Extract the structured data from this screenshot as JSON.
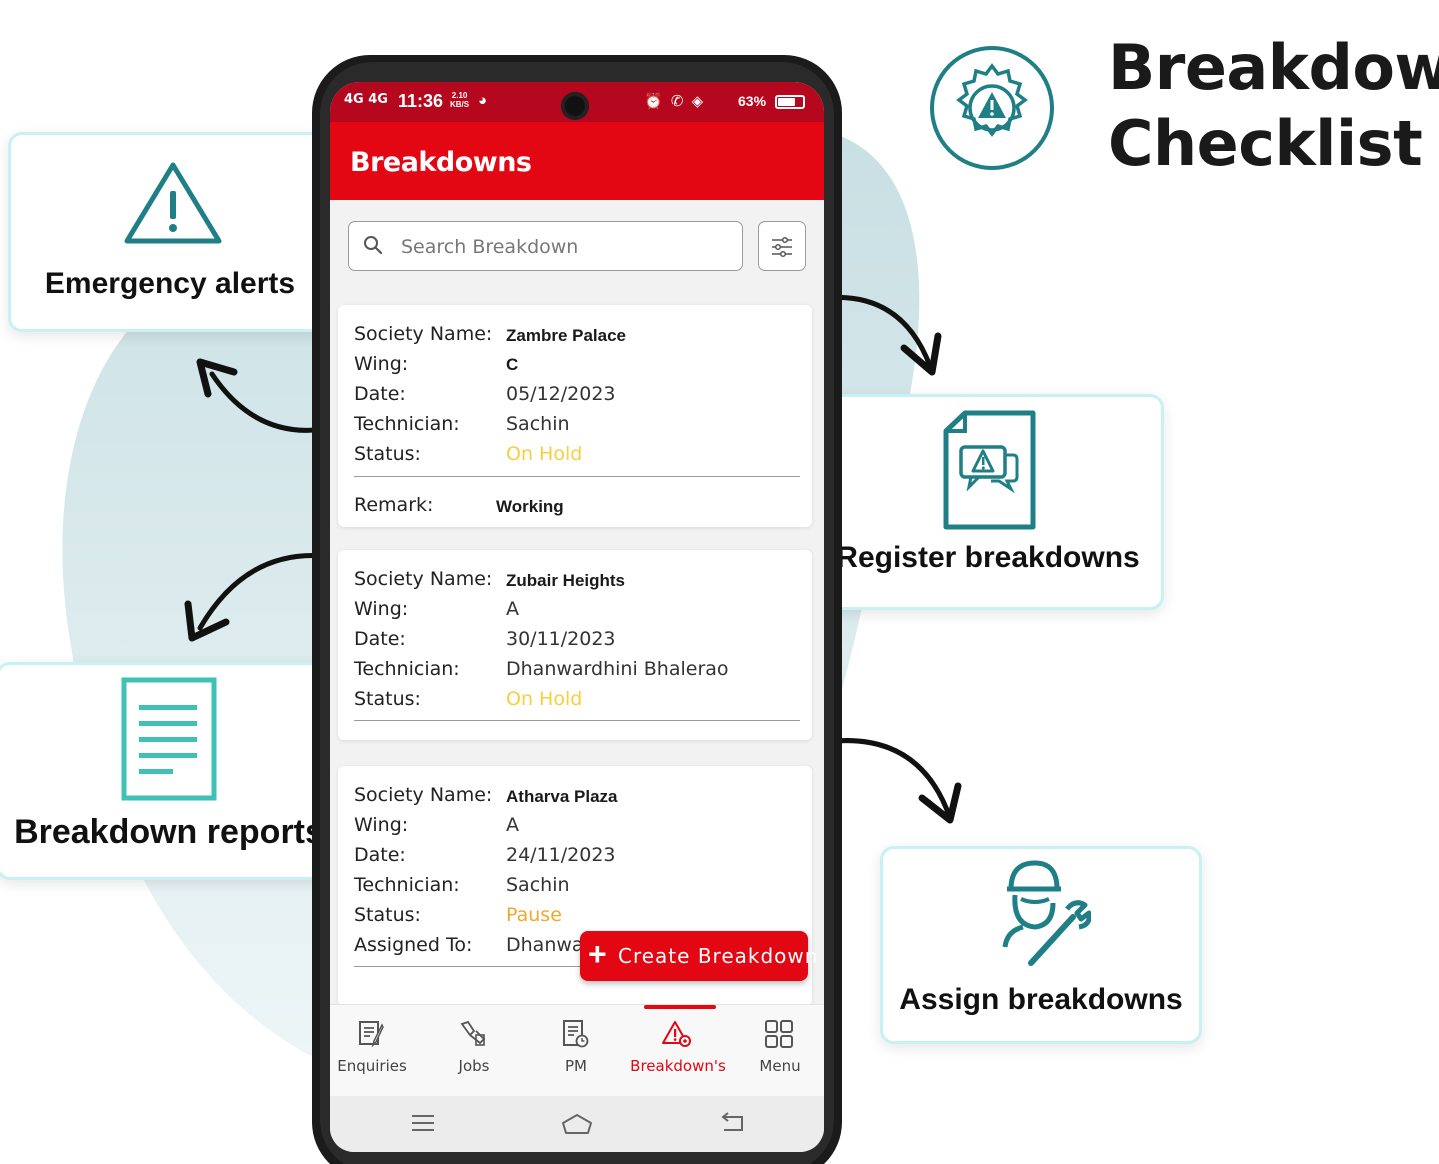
{
  "brand": {
    "title_line1": "Breakdown",
    "title_line2": "Checklist"
  },
  "features": {
    "alerts": "Emergency alerts",
    "reports": "Breakdown reports",
    "register": "Register breakdowns",
    "assign": "Assign breakdowns"
  },
  "statusbar": {
    "signal": "4G 4G",
    "time": "11:36",
    "speed_value": "2.10",
    "speed_unit": "KB/S",
    "battery": "63%"
  },
  "appbar": {
    "title": "Breakdowns"
  },
  "search": {
    "placeholder": "Search Breakdown"
  },
  "cards": [
    {
      "society_label": "Society Name:",
      "society": "Zambre Palace",
      "wing_label": "Wing:",
      "wing": "C",
      "date_label": "Date:",
      "date": "05/12/2023",
      "tech_label": "Technician:",
      "technician": "Sachin",
      "status_label": "Status:",
      "status": "On Hold",
      "remark_label": "Remark:",
      "remark": "Working"
    },
    {
      "society_label": "Society Name:",
      "society": "Zubair Heights",
      "wing_label": "Wing:",
      "wing": "A",
      "date_label": "Date:",
      "date": "30/11/2023",
      "tech_label": "Technician:",
      "technician": "Dhanwardhini Bhalerao",
      "status_label": "Status:",
      "status": "On Hold"
    },
    {
      "society_label": "Society Name:",
      "society": "Atharva Plaza",
      "wing_label": "Wing:",
      "wing": "A",
      "date_label": "Date:",
      "date": "24/11/2023",
      "tech_label": "Technician:",
      "technician": "Sachin",
      "status_label": "Status:",
      "status": "Pause",
      "assigned_label": "Assigned To:",
      "assigned": "Dhanwa"
    }
  ],
  "fab": {
    "icon": "+",
    "label": "Create Breakdown"
  },
  "nav": [
    {
      "label": "Enquiries",
      "icon": "enquiries-icon"
    },
    {
      "label": "Jobs",
      "icon": "jobs-icon"
    },
    {
      "label": "PM",
      "icon": "pm-icon"
    },
    {
      "label": "Breakdown's",
      "icon": "breakdown-icon",
      "active": true
    },
    {
      "label": "Menu",
      "icon": "menu-grid-icon"
    }
  ],
  "colors": {
    "brand_red": "#e30613",
    "teal": "#1f7f86",
    "light_teal": "#3fc1b5",
    "on_hold": "#f4d03f",
    "pause": "#f0a830"
  }
}
